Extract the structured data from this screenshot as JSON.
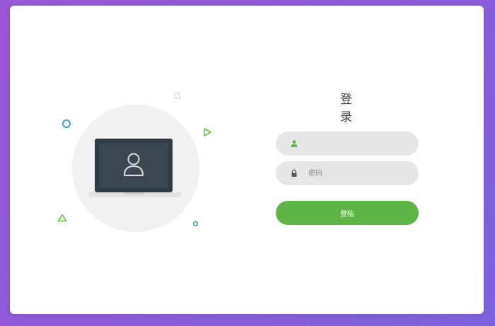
{
  "login": {
    "title": "登录",
    "username": {
      "value": "",
      "placeholder": "",
      "icon": "user-icon"
    },
    "password": {
      "value": "",
      "placeholder": "密码",
      "icon": "lock-icon"
    },
    "submit_label": "登陆"
  },
  "illustration": {
    "laptop_icon": "laptop-icon",
    "user_icon": "user-outline-icon",
    "shapes": [
      "circle-outline",
      "square-outline",
      "triangle-outline",
      "triangle-outline",
      "circle-outline"
    ]
  },
  "colors": {
    "background_gradient_start": "#9a57d6",
    "background_gradient_end": "#7b62dc",
    "accent_green": "#5cb545",
    "field_background": "#e6e6e6",
    "teal_shape": "#3aa3c8",
    "green_shape": "#6cc04a"
  }
}
